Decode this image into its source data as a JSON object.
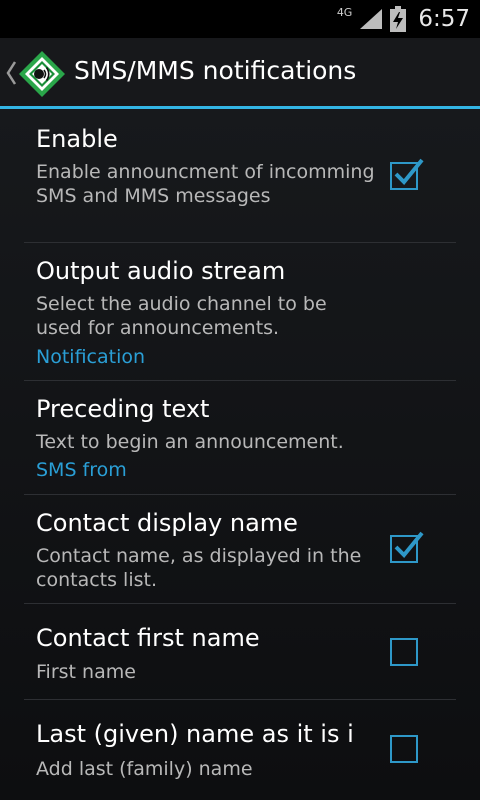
{
  "status": {
    "network": "4G",
    "time": "6:57"
  },
  "header": {
    "title": "SMS/MMS notifications"
  },
  "items": [
    {
      "title": "Enable",
      "summary": "Enable announcment of incomming SMS and MMS messages",
      "checked": true
    },
    {
      "title": "Output audio stream",
      "summary": "Select the audio channel to be used for announcements.",
      "value": "Notification"
    },
    {
      "title": "Preceding text",
      "summary": "Text to begin an announcement.",
      "value": "SMS from"
    },
    {
      "title": "Contact display name",
      "summary": "Contact name, as displayed in the contacts list.",
      "checked": true
    },
    {
      "title": "Contact first name",
      "summary": "First name",
      "checked": false
    },
    {
      "title": "Last (given) name as it is in the contact",
      "summary": "Add last (family) name",
      "checked": false
    }
  ],
  "colors": {
    "accent": "#33b5e5",
    "checkbox": "#2e98c8",
    "value_text": "#2a9fd6"
  },
  "icons": {
    "app": "speaker-shield-icon",
    "back": "chevron-left-icon",
    "check": "checkmark-icon"
  }
}
